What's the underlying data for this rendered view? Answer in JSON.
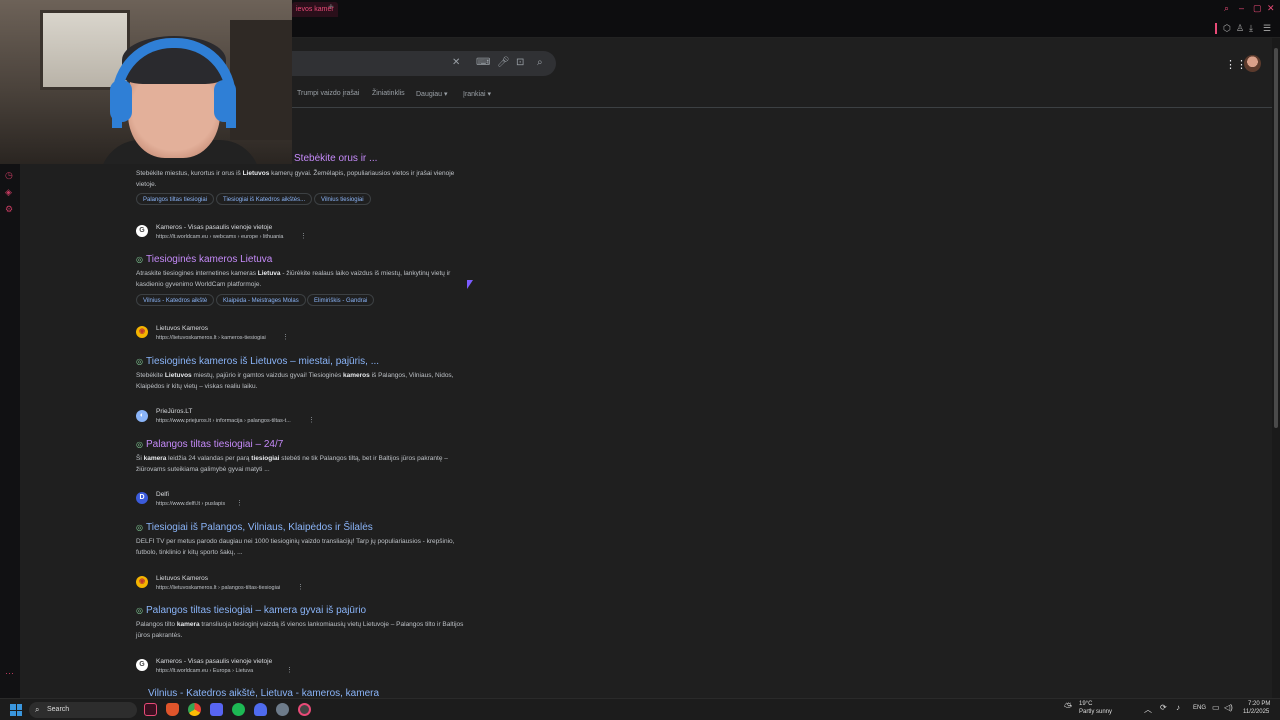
{
  "browser": {
    "tab_label": "ievos kamer",
    "new_tab": "+"
  },
  "google": {
    "tabs": [
      "Trumpi vaizdo įrašai",
      "Žiniatinklis",
      "Daugiau",
      "Įrankiai"
    ]
  },
  "results": [
    {
      "title": "Stebėkite orus ir ...",
      "snippet_html": "Stebėkite miestus, kurortus ir orus iš <b>Lietuvos</b> kamerų gyvai. Žemėlapis, populiariausios vietos ir įrašai vienoje vietoje.",
      "chips": [
        "Palangos tiltas tiesiogiai",
        "Tiesiogiai iš Katedros aikštės...",
        "Vilnius tiesiogiai"
      ]
    },
    {
      "site": "Kameros - Visas pasaulis vienoje vietoje",
      "url": "https://lt.worldcam.eu › webcams › europe › lithuania",
      "title": "Tiesioginės kameros Lietuva",
      "snippet_html": "Atraskite tiesiogines internetines kameras <b>Lietuva</b> - žiūrėkite realaus laiko vaizdus iš miestų, lankytinų vietų ir kasdienio gyvenimo WorldCam platformoje.",
      "chips": [
        "Vilnius - Katedros aikštė",
        "Klaipėda - Meistrages Molas",
        "Elimiriškis - Gandrai"
      ]
    },
    {
      "site": "Lietuvos Kameros",
      "url": "https://lietuvoskameros.lt › kameros-tiesiogiai",
      "title": "Tiesioginės kameros iš Lietuvos – miestai, pajūris, ...",
      "snippet_html": "Stebėkite <b>Lietuvos</b> miestų, pajūrio ir gamtos vaizdus gyvai! Tiesioginės <b>kameros</b> iš Palangos, Vilniaus, Nidos, Klaipėdos ir kitų vietų – viskas realiu laiku."
    },
    {
      "site": "PrieJūros.LT",
      "url": "https://www.priejuros.lt › informacija › palangos-tiltas-t...",
      "title": "Palangos tiltas tiesiogiai – 24/7",
      "snippet_html": "Ši <b>kamera</b> leidžia 24 valandas per parą <b>tiesiogiai</b> stebėti ne tik Palangos tiltą, bet ir Baltijos jūros pakrantę – žiūrovams suteikiama galimybė gyvai matyti ..."
    },
    {
      "site": "Delfi",
      "url": "https://www.delfi.lt › puslapis",
      "title": "Tiesiogiai iš Palangos, Vilniaus, Klaipėdos ir Šilalės",
      "snippet_html": "DELFI TV per metus parodo daugiau nei 1000 tiesioginių vaizdo transliacijų! Tarp jų populiariausios - krepšinio, futbolo, tinklinio ir kitų sporto šakų, ..."
    },
    {
      "site": "Lietuvos Kameros",
      "url": "https://lietuvoskameros.lt › palangos-tiltas-tiesiogiai",
      "title": "Palangos tiltas tiesiogiai – kamera gyvai iš pajūrio",
      "snippet_html": "Palangos tilto <b>kamera</b> transliuoja tiesioginį vaizdą iš vienos lankomiausių vietų Lietuvoje – Palangos tilto ir Baltijos jūros pakrantės."
    },
    {
      "site": "Kameros - Visas pasaulis vienoje vietoje",
      "url": "https://lt.worldcam.eu › Europa › Lietuva",
      "title": "Vilnius - Katedros aikštė, Lietuva - kameros, kamera"
    }
  ],
  "taskbar": {
    "search": "Search",
    "weather_temp": "19°C",
    "weather_desc": "Partly sunny",
    "lang": "ENG",
    "time": "7:20 PM",
    "date": "11/2/2025"
  },
  "colors": {
    "link": "#8ab4f8",
    "visited": "#c58af9",
    "accent": "#e84a77"
  }
}
